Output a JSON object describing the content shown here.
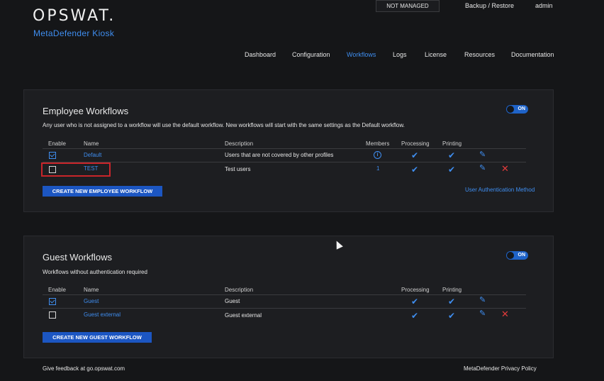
{
  "brand": {
    "logo": "OPSWAT.",
    "product": "MetaDefender Kiosk"
  },
  "top_bar": {
    "status_badge": "NOT MANAGED",
    "backup_link": "Backup / Restore",
    "user": "admin"
  },
  "nav": [
    "Dashboard",
    "Configuration",
    "Workflows",
    "Logs",
    "License",
    "Resources",
    "Documentation"
  ],
  "nav_active": "Workflows",
  "employee": {
    "title": "Employee Workflows",
    "description": "Any user who is not assigned to a workflow will use the default workflow. New workflows will start with the same settings as the Default workflow.",
    "toggle": "ON",
    "headers": {
      "enable": "Enable",
      "name": "Name",
      "description": "Description",
      "members": "Members",
      "processing": "Processing",
      "printing": "Printing"
    },
    "rows": [
      {
        "name": "Default",
        "description": "Users that are not covered by other profiles",
        "members": "",
        "enabled": true
      },
      {
        "name": "TEST",
        "description": "Test users",
        "members": "1",
        "enabled": false
      }
    ],
    "create_button": "CREATE NEW EMPLOYEE WORKFLOW",
    "auth_link": "User Authentication Method"
  },
  "guest": {
    "title": "Guest Workflows",
    "description": "Workflows without authentication required",
    "toggle": "ON",
    "headers": {
      "enable": "Enable",
      "name": "Name",
      "description": "Description",
      "processing": "Processing",
      "printing": "Printing"
    },
    "rows": [
      {
        "name": "Guest",
        "description": "Guest",
        "enabled": true
      },
      {
        "name": "Guest external",
        "description": "Guest external",
        "enabled": false
      }
    ],
    "create_button": "CREATE NEW GUEST WORKFLOW"
  },
  "footer": {
    "feedback": "Give feedback at go.opswat.com",
    "privacy": "MetaDefender Privacy Policy"
  },
  "icons": {
    "check": "check-icon",
    "edit": "pencil-icon",
    "delete": "close-icon",
    "info": "info-icon"
  },
  "colors": {
    "accent": "#3f8ef0",
    "button": "#1c56c2",
    "delete": "#e23b3b",
    "highlight": "#c9252a",
    "background": "#151618",
    "panel": "#1d1e21"
  }
}
